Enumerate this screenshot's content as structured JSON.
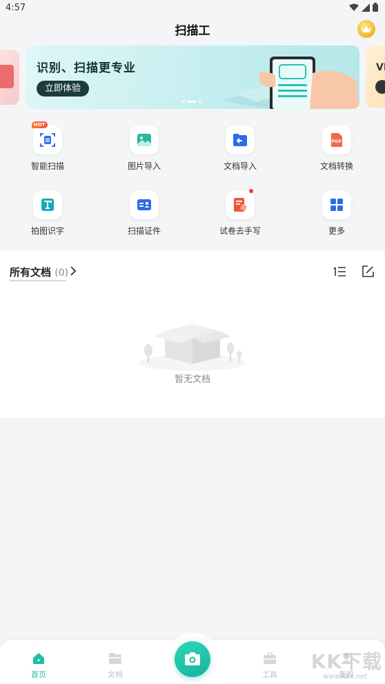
{
  "status_bar": {
    "time": "4:57"
  },
  "header": {
    "title": "扫描工"
  },
  "banner": {
    "title": "识别、扫描更专业",
    "button_label": "立即体验",
    "next_peek_text": "VI",
    "dots": 3,
    "active_dot": 1
  },
  "tools": [
    {
      "label": "智能扫描",
      "icon": "smart-scan-icon",
      "badge": "HOT"
    },
    {
      "label": "图片导入",
      "icon": "image-import-icon"
    },
    {
      "label": "文档导入",
      "icon": "document-import-icon"
    },
    {
      "label": "文档转换",
      "icon": "pdf-convert-icon"
    },
    {
      "label": "拍图识字",
      "icon": "text-recognize-icon"
    },
    {
      "label": "扫描证件",
      "icon": "id-card-scan-icon"
    },
    {
      "label": "试卷去手写",
      "icon": "exam-erase-icon",
      "dot": true
    },
    {
      "label": "更多",
      "icon": "more-grid-icon"
    }
  ],
  "documents": {
    "title": "所有文档",
    "count": "(0)",
    "empty_text": "暂无文档"
  },
  "bottom_nav": {
    "items": [
      {
        "label": "首页",
        "icon": "home-icon",
        "active": true
      },
      {
        "label": "文档",
        "icon": "folder-icon"
      },
      {
        "label": "工具",
        "icon": "toolbox-icon"
      },
      {
        "label": "我的",
        "icon": "profile-icon"
      }
    ]
  },
  "watermark": {
    "text": "KK下载",
    "sub": "www.kkx.net"
  },
  "colors": {
    "accent": "#1fbfa5",
    "banner_button": "#1d3b3e",
    "hot": "#f4512c"
  }
}
